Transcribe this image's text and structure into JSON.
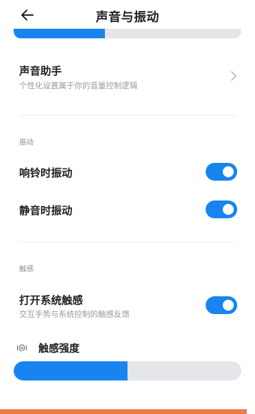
{
  "header": {
    "title": "声音与振动"
  },
  "volume_slider": {
    "level": 0.4
  },
  "sound_assistant": {
    "title": "声音助手",
    "subtitle": "个性化设置属于你的音量控制逻辑"
  },
  "vibration_section": {
    "label": "振动",
    "items": [
      {
        "label": "响铃时振动",
        "enabled": true
      },
      {
        "label": "静音时振动",
        "enabled": true
      }
    ]
  },
  "haptics_section": {
    "label": "触感",
    "system_haptics": {
      "title": "打开系统触感",
      "subtitle": "交互手势与系统控制的触感反馈",
      "enabled": true
    },
    "intensity": {
      "label": "触感强度",
      "level": 0.5
    }
  },
  "colors": {
    "accent": "#1784f0",
    "track": "#e4e6ea",
    "bottom_strip": "#ee7a45"
  },
  "icons": {
    "back": "back-arrow-icon",
    "chevron": "chevron-right-icon",
    "haptic": "fingerprint-vibration-icon"
  }
}
